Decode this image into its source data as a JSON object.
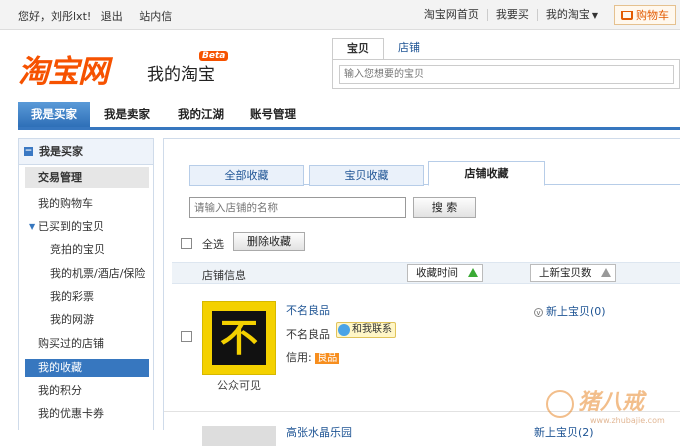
{
  "topbar": {
    "greeting": "您好，刘彤lxt!",
    "logout": "退出",
    "messages": "站内信",
    "home": "淘宝网首页",
    "buy": "我要买",
    "my_taobao": "我的淘宝",
    "cart": "购物车"
  },
  "header": {
    "logo": "淘宝网",
    "subtitle": "我的淘宝",
    "beta": "Beta"
  },
  "search": {
    "tab_items": "宝贝",
    "tab_shops": "店铺",
    "placeholder": "输入您想要的宝贝"
  },
  "mainnav": {
    "items": [
      "我是买家",
      "我是卖家",
      "我的江湖",
      "账号管理"
    ],
    "active_index": 0
  },
  "sidebar": {
    "header": "我是买家",
    "section": "交易管理",
    "items": [
      {
        "label": "我的购物车",
        "sub": false,
        "expand": false
      },
      {
        "label": "已买到的宝贝",
        "sub": false,
        "expand": true
      },
      {
        "label": "竞拍的宝贝",
        "sub": true,
        "expand": false
      },
      {
        "label": "我的机票/酒店/保险",
        "sub": true,
        "expand": false
      },
      {
        "label": "我的彩票",
        "sub": true,
        "expand": false
      },
      {
        "label": "我的网游",
        "sub": true,
        "expand": false
      },
      {
        "label": "购买过的店铺",
        "sub": false,
        "expand": false
      },
      {
        "label": "我的收藏",
        "sub": false,
        "expand": false,
        "active": true
      },
      {
        "label": "我的积分",
        "sub": false,
        "expand": false
      },
      {
        "label": "我的优惠卡券",
        "sub": false,
        "expand": false
      }
    ]
  },
  "content": {
    "tabs": [
      "全部收藏",
      "宝贝收藏",
      "店铺收藏"
    ],
    "active_tab": 2,
    "shop_input_placeholder": "请输入店铺的名称",
    "search_button": "搜 索",
    "select_all": "全选",
    "delete_button": "删除收藏",
    "col_shop_info": "店铺信息",
    "col_fav_time": "收藏时间",
    "col_new_items": "上新宝贝数",
    "rows": [
      {
        "shop_name": "不名良品",
        "logo_char": "不",
        "visibility": "公众可见",
        "seller": "不名良品",
        "contact": "和我联系",
        "credit_label": "信用:",
        "credit_badge": "良品",
        "new_items": "新上宝贝(0)"
      },
      {
        "shop_name": "高张水晶乐园",
        "new_items": "新上宝贝(2)"
      }
    ]
  },
  "watermark": {
    "brand": "猪八戒",
    "url": "www.zhubajie.com"
  },
  "colors": {
    "brand_orange": "#f65200",
    "nav_blue": "#3777bf",
    "link_blue": "#1e5494"
  }
}
